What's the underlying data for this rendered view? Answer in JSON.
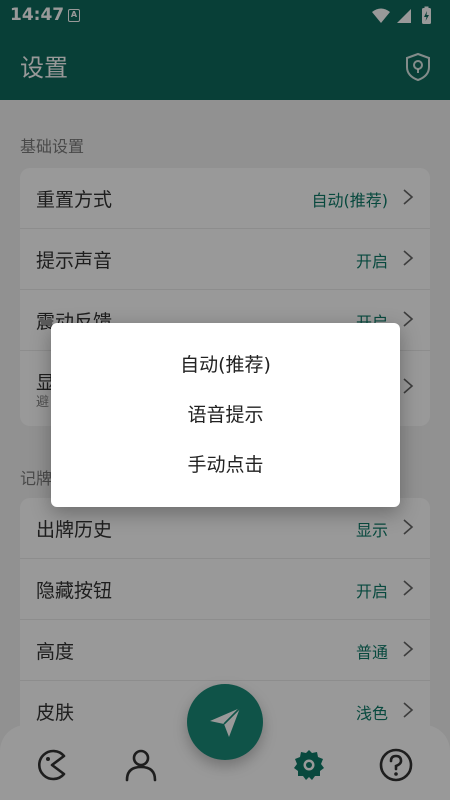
{
  "status_bar": {
    "time": "14:47",
    "notification_badge": "A"
  },
  "app_bar": {
    "title": "设置",
    "icon": "shield-location-icon"
  },
  "sections": [
    {
      "label": "基础设置",
      "items": [
        {
          "label": "重置方式",
          "value": "自动(推荐)"
        },
        {
          "label": "提示声音",
          "value": "开启"
        },
        {
          "label": "震动反馈",
          "value": "开启"
        },
        {
          "label": "显",
          "sub": "避",
          "value": ""
        }
      ]
    },
    {
      "label": "记牌",
      "items": [
        {
          "label": "出牌历史",
          "value": "显示"
        },
        {
          "label": "隐藏按钮",
          "value": "开启"
        },
        {
          "label": "高度",
          "value": "普通"
        },
        {
          "label": "皮肤",
          "value": "浅色"
        }
      ]
    }
  ],
  "dialog": {
    "options": [
      "自动(推荐)",
      "语音提示",
      "手动点击"
    ]
  },
  "bottom_nav": {
    "items": [
      "pacman-icon",
      "profile-icon",
      "send-icon",
      "settings-gear-icon",
      "help-icon"
    ],
    "active": "settings-gear-icon",
    "accent": "#0e7a68"
  },
  "colors": {
    "primary": "#0e6a5c",
    "accent": "#0e7a68",
    "fab": "#1a8a78"
  }
}
